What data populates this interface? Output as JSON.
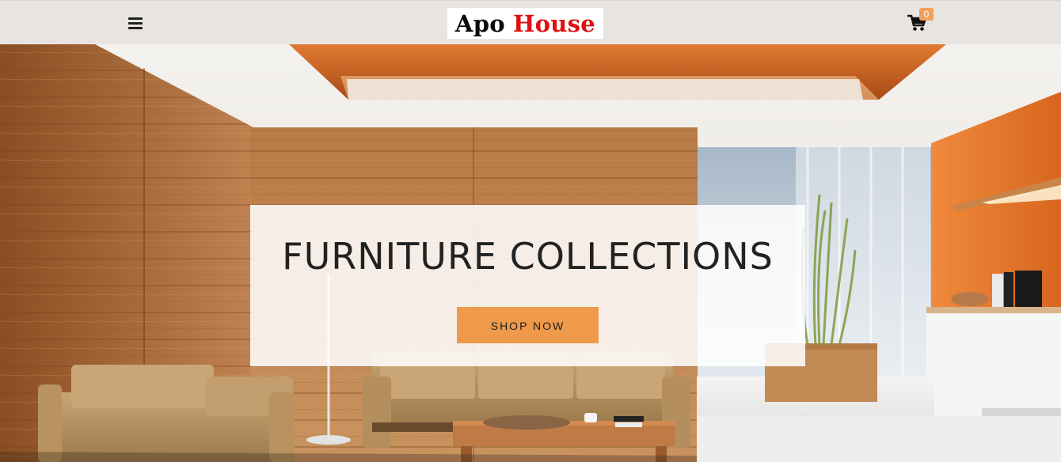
{
  "header": {
    "logo_word1": "Apo",
    "logo_word2": "House",
    "cart_count": "0"
  },
  "hero": {
    "title": "FURNITURE COLLECTIONS",
    "button_label": "SHOP NOW"
  },
  "icons": {
    "menu": "hamburger-menu-icon",
    "cart": "shopping-cart-icon"
  },
  "colors": {
    "header_bg": "#e8e4e0",
    "accent": "#ee9a4a",
    "logo_red": "#e01010",
    "badge": "#f0a05a"
  }
}
